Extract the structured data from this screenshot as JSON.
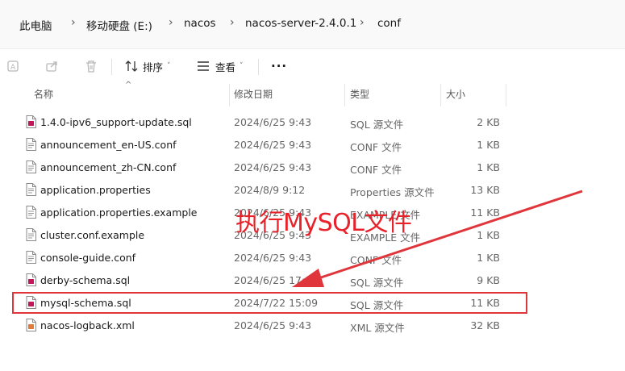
{
  "breadcrumb": [
    "此电脑",
    "移动硬盘 (E:)",
    "nacos",
    "nacos-server-2.4.0.1",
    "conf"
  ],
  "toolbar": {
    "sort_label": "排序",
    "view_label": "查看",
    "more_label": "···"
  },
  "columns": {
    "name": "名称",
    "modified": "修改日期",
    "type": "类型",
    "size": "大小"
  },
  "files": [
    {
      "name": "1.4.0-ipv6_support-update.sql",
      "modified": "2024/6/25 9:43",
      "type": "SQL 源文件",
      "size": "2 KB",
      "icon": "sql-file-icon"
    },
    {
      "name": "announcement_en-US.conf",
      "modified": "2024/6/25 9:43",
      "type": "CONF 文件",
      "size": "1 KB",
      "icon": "text-file-icon"
    },
    {
      "name": "announcement_zh-CN.conf",
      "modified": "2024/6/25 9:43",
      "type": "CONF 文件",
      "size": "1 KB",
      "icon": "text-file-icon"
    },
    {
      "name": "application.properties",
      "modified": "2024/8/9 9:12",
      "type": "Properties 源文件",
      "size": "13 KB",
      "icon": "text-file-icon"
    },
    {
      "name": "application.properties.example",
      "modified": "2024/6/25 9:43",
      "type": "EXAMPLE 文件",
      "size": "11 KB",
      "icon": "text-file-icon"
    },
    {
      "name": "cluster.conf.example",
      "modified": "2024/6/25 9:43",
      "type": "EXAMPLE 文件",
      "size": "1 KB",
      "icon": "text-file-icon"
    },
    {
      "name": "console-guide.conf",
      "modified": "2024/6/25 9:43",
      "type": "CONF 文件",
      "size": "1 KB",
      "icon": "text-file-icon"
    },
    {
      "name": "derby-schema.sql",
      "modified": "2024/6/25 17:",
      "type": "SQL 源文件",
      "size": "9 KB",
      "icon": "sql-file-icon"
    },
    {
      "name": "mysql-schema.sql",
      "modified": "2024/7/22 15:09",
      "type": "SQL 源文件",
      "size": "11 KB",
      "icon": "sql-file-icon"
    },
    {
      "name": "nacos-logback.xml",
      "modified": "2024/6/25 9:43",
      "type": "XML 源文件",
      "size": "32 KB",
      "icon": "xml-file-icon"
    }
  ],
  "annotation": {
    "text": "执行MySQL文件",
    "color": "#e8222a"
  },
  "colors": {
    "highlight": "#e0353b",
    "sql_icon": "#c2185b",
    "xml_icon": "#e07b39"
  }
}
